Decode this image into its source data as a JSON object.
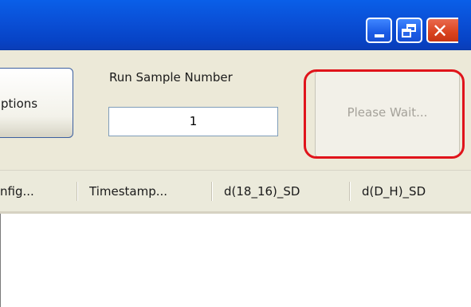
{
  "window": {
    "controls": {
      "minimize_icon": "minimize-icon",
      "maximize_icon": "restore-icon",
      "close_icon": "close-icon",
      "close_glyph": "✕"
    }
  },
  "toolbar": {
    "options_label": "ptions",
    "run_sample_label": "Run Sample Number",
    "run_sample_value": "1",
    "wait_label": "Please Wait..."
  },
  "table": {
    "columns": [
      "nfig...",
      "Timestamp...",
      "d(18_16)_SD",
      "d(D_H)_SD"
    ]
  },
  "colors": {
    "titlebar": "#0a4fd6",
    "close_button": "#d9431f",
    "highlight": "#e0141b",
    "panel": "#ece9d8"
  }
}
